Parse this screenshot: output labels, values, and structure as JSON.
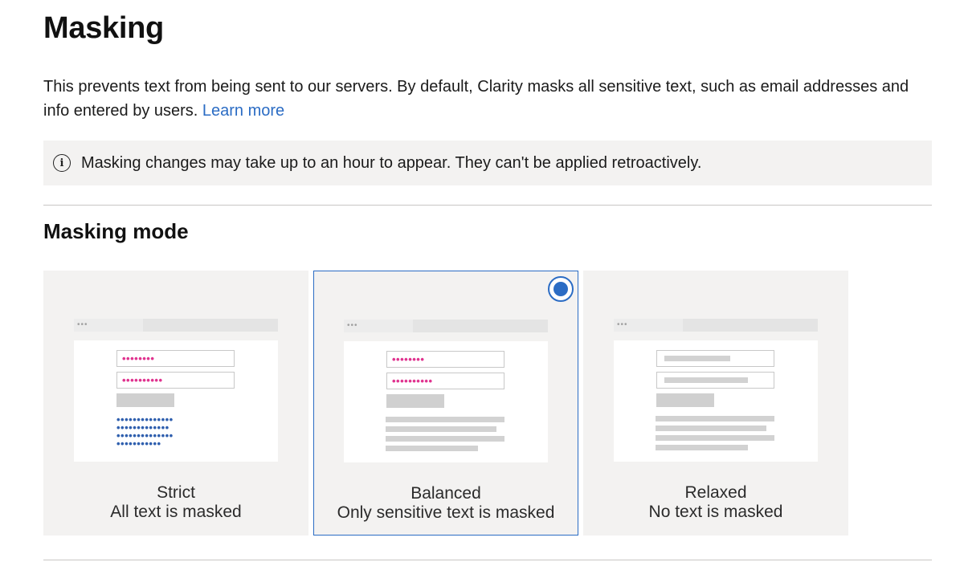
{
  "page": {
    "title": "Masking",
    "description": "This prevents text from being sent to our servers. By default, Clarity masks all sensitive text, such as email addresses and info entered by users.",
    "learn_more": "Learn more"
  },
  "info_bar": {
    "icon": "info-icon",
    "text": "Masking changes may take up to an hour to appear. They can't be applied retroactively."
  },
  "masking_mode": {
    "title": "Masking mode",
    "selected": "Balanced",
    "options": [
      {
        "name": "Strict",
        "subtitle": "All text is masked",
        "selected": false
      },
      {
        "name": "Balanced",
        "subtitle": "Only sensitive text is masked",
        "selected": true
      },
      {
        "name": "Relaxed",
        "subtitle": "No text is masked",
        "selected": false
      }
    ]
  },
  "illustration": {
    "browser_dots": "•••",
    "pink_dots_short": "••••••••",
    "pink_dots_long": "••••••••••",
    "blue_dots_row_1": "••••••••••••••",
    "blue_dots_row_2": "•••••••••••••",
    "blue_dots_row_3": "••••••••••••••",
    "blue_dots_row_4": "•••••••••••"
  },
  "colors": {
    "accent": "#2b6cc4",
    "masked_sensitive": "#e0338f",
    "masked_text": "#2f5fae",
    "card_background": "#f3f2f1"
  }
}
